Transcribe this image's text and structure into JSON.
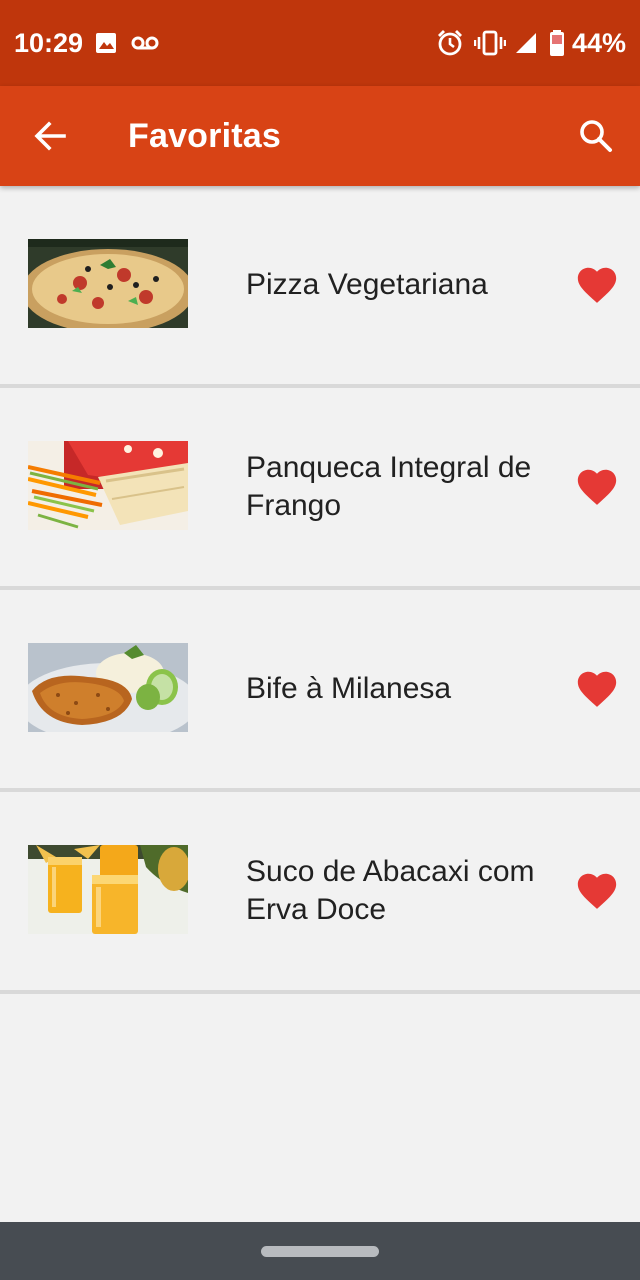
{
  "status_bar": {
    "time": "10:29",
    "battery": "44%",
    "icons": [
      "image-icon",
      "voicemail-icon",
      "alarm-icon",
      "vibrate-icon",
      "signal-icon",
      "battery-icon"
    ]
  },
  "app_bar": {
    "title": "Favoritas",
    "back_icon": "arrow-back-icon",
    "search_icon": "search-icon"
  },
  "favorites": [
    {
      "title": "Pizza Vegetariana",
      "favorite": true,
      "image": "pizza-photo"
    },
    {
      "title": "Panqueca Integral de Frango",
      "favorite": true,
      "image": "pancake-photo"
    },
    {
      "title": "Bife à Milanesa",
      "favorite": true,
      "image": "steak-photo"
    },
    {
      "title": "Suco de Abacaxi com Erva Doce",
      "favorite": true,
      "image": "juice-photo"
    }
  ],
  "colors": {
    "status_bar": "#bf360c",
    "app_bar": "#d84315",
    "background": "#f2f2f2",
    "heart": "#e53935",
    "nav_bar": "#474c52"
  }
}
